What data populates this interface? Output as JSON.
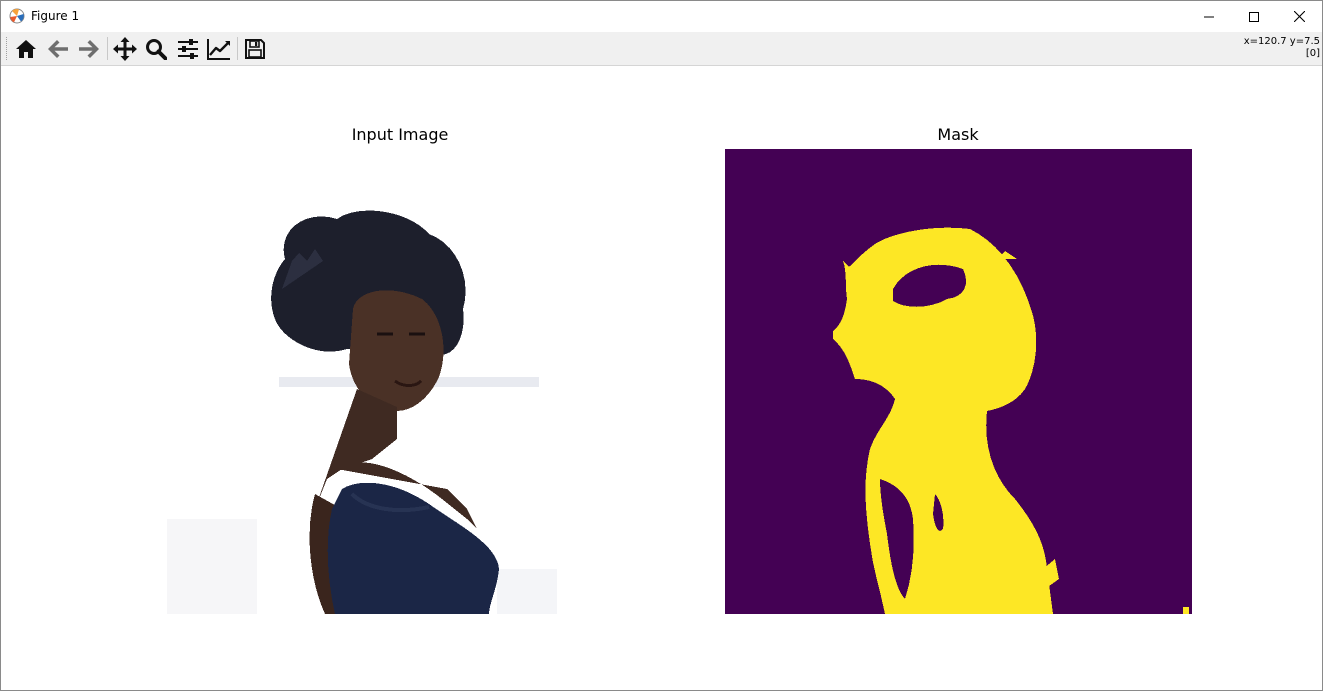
{
  "window": {
    "title": "Figure 1",
    "minimize_icon": "minimize-icon",
    "maximize_icon": "maximize-icon",
    "close_icon": "close-icon"
  },
  "toolbar": {
    "buttons": [
      {
        "name": "home-button",
        "icon": "home-icon"
      },
      {
        "name": "back-button",
        "icon": "arrow-left-icon"
      },
      {
        "name": "forward-button",
        "icon": "arrow-right-icon"
      },
      {
        "name": "pan-button",
        "icon": "move-icon"
      },
      {
        "name": "zoom-button",
        "icon": "magnifier-icon"
      },
      {
        "name": "subplots-button",
        "icon": "sliders-icon"
      },
      {
        "name": "edit-axes-button",
        "icon": "line-chart-icon"
      },
      {
        "name": "save-button",
        "icon": "floppy-disk-icon"
      }
    ],
    "coords_line1": "x=120.7 y=7.5",
    "coords_line2": "[0]"
  },
  "figure": {
    "left_title": "Input Image",
    "right_title": "Mask",
    "mask_colors": {
      "background": "#440154",
      "foreground": "#fde725"
    }
  }
}
